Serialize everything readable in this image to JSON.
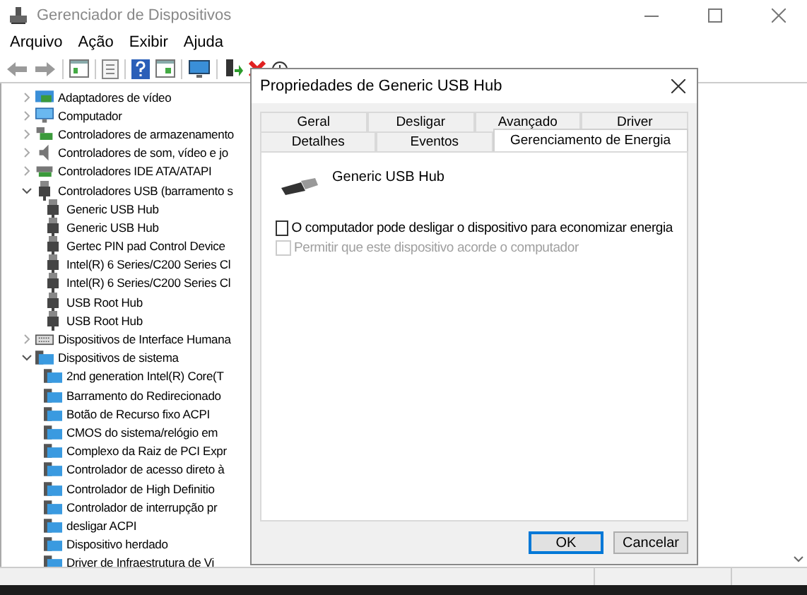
{
  "window": {
    "title": "Gerenciador de Dispositivos"
  },
  "menu": [
    "Arquivo",
    "Ação",
    "Exibir",
    "Ajuda"
  ],
  "tree": [
    {
      "label": "Adaptadores de vídeo",
      "kind": "display",
      "expanded": false
    },
    {
      "label": "Computador",
      "kind": "monitor",
      "expanded": false
    },
    {
      "label": "Controladores de armazenamento",
      "kind": "storage",
      "expanded": false
    },
    {
      "label": "Controladores de som, vídeo e jo",
      "kind": "sound",
      "expanded": false
    },
    {
      "label": "Controladores IDE ATA/ATAPI",
      "kind": "ide",
      "expanded": false
    },
    {
      "label": "Controladores USB (barramento s",
      "kind": "usb",
      "expanded": true,
      "children": [
        {
          "label": "Generic USB Hub",
          "kind": "usb"
        },
        {
          "label": "Generic USB Hub",
          "kind": "usb"
        },
        {
          "label": "Gertec PIN pad Control Device",
          "kind": "usb"
        },
        {
          "label": "Intel(R) 6 Series/C200 Series Cl",
          "kind": "usb"
        },
        {
          "label": "Intel(R) 6 Series/C200 Series Cl",
          "kind": "usb"
        },
        {
          "label": "USB Root Hub",
          "kind": "usb"
        },
        {
          "label": "USB Root Hub",
          "kind": "usb"
        }
      ]
    },
    {
      "label": "Dispositivos de Interface Humana",
      "kind": "hid",
      "expanded": false
    },
    {
      "label": "Dispositivos de sistema",
      "kind": "system",
      "expanded": true,
      "children": [
        {
          "label": "2nd generation Intel(R) Core(T",
          "kind": "system"
        },
        {
          "label": "Barramento do Redirecionado",
          "kind": "system"
        },
        {
          "label": "Botão de Recurso fixo ACPI",
          "kind": "system"
        },
        {
          "label": "CMOS do sistema/relógio em",
          "kind": "system"
        },
        {
          "label": "Complexo da Raiz de PCI Expr",
          "kind": "system"
        },
        {
          "label": "Controlador de acesso direto à",
          "kind": "system"
        },
        {
          "label": "Controlador de High Definitio",
          "kind": "system"
        },
        {
          "label": "Controlador de interrupção pr",
          "kind": "system"
        },
        {
          "label": "desligar ACPI",
          "kind": "system"
        },
        {
          "label": "Dispositivo herdado",
          "kind": "system"
        },
        {
          "label": "Driver de Infraestrutura de Vi",
          "kind": "system"
        }
      ]
    }
  ],
  "dialog": {
    "title": "Propriedades de Generic USB Hub",
    "tab_rows": [
      [
        {
          "label": "Geral",
          "selected": false
        },
        {
          "label": "Desligar",
          "selected": false
        },
        {
          "label": "Avançado",
          "selected": false
        },
        {
          "label": "Driver",
          "selected": false
        }
      ],
      [
        {
          "label": "Detalhes",
          "selected": false
        },
        {
          "label": "Eventos",
          "selected": false
        },
        {
          "label": "Gerenciamento de Energia",
          "selected": true
        }
      ]
    ],
    "device_name": "Generic USB Hub",
    "options": [
      {
        "label": "O computador pode desligar o dispositivo para economizar energia",
        "checked": false,
        "disabled": false
      },
      {
        "label": "Permitir que este dispositivo acorde o computador",
        "checked": false,
        "disabled": true
      }
    ],
    "buttons": [
      {
        "label": "OK",
        "default": true
      },
      {
        "label": "Cancelar",
        "default": false
      }
    ]
  }
}
